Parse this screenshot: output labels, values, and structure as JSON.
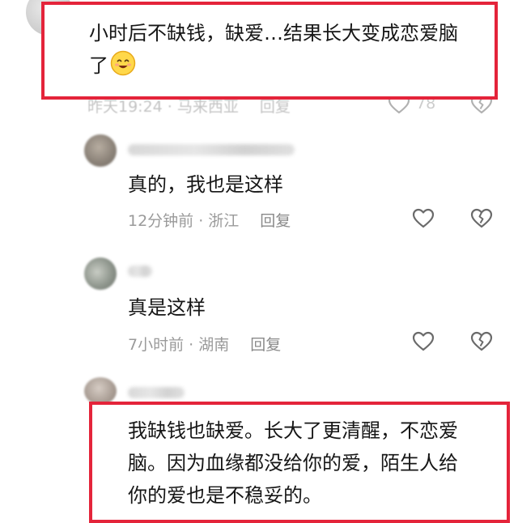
{
  "comments": [
    {
      "text_line1": "小时后不缺钱，缺爱…结果长大变成恋爱脑",
      "text_line2": "了",
      "time": "昨天19:24 · 马来西亚",
      "reply": "回复",
      "likes": "78"
    },
    {
      "text": "真的，我也是这样",
      "time": "12分钟前 · 浙江",
      "reply": "回复"
    },
    {
      "text": "真是这样",
      "time": "7小时前 · 湖南",
      "reply": "回复"
    },
    {
      "text_line1": "我缺钱也缺爱。长大了更清醒，不恋爱",
      "text_line2": "脑。因为血缘都没给你的爱，陌生人给",
      "text_line3": "你的爱也是不稳妥的。"
    }
  ],
  "colors": {
    "highlight": "#e4243a",
    "meta": "#9a9a9a",
    "text": "#161616"
  },
  "icons": {
    "like": "heart-outline-icon",
    "dislike": "broken-heart-icon",
    "emoji": "smile-emoji-icon"
  }
}
